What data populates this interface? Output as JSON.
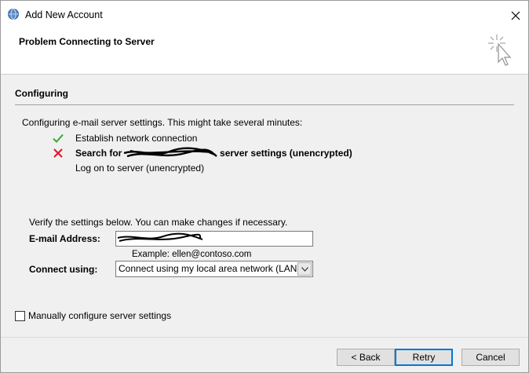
{
  "window": {
    "title": "Add New Account",
    "icon": "outlook-account-icon"
  },
  "header": {
    "title": "Problem Connecting to Server",
    "icon": "wizard-cursor-icon"
  },
  "section": {
    "title": "Configuring"
  },
  "progress": {
    "intro": "Configuring e-mail server settings. This might take several minutes:",
    "steps": [
      {
        "label": "Establish network connection",
        "status": "success",
        "icon": "check-icon"
      },
      {
        "label": "Search for ",
        "label_suffix": " server settings (unencrypted)",
        "status": "failed",
        "icon": "error-x-icon"
      },
      {
        "label": "Log on to server (unencrypted)",
        "status": "pending"
      }
    ]
  },
  "form": {
    "verify_text": "Verify the settings below. You can make changes if necessary.",
    "email_label": "E-mail Address:",
    "email_value": "",
    "email_example": "Example: ellen@contoso.com",
    "connect_label": "Connect using:",
    "connect_value": "Connect using my local area network (LAN)",
    "manual_label": "Manually configure server settings",
    "manual_checked": false
  },
  "buttons": {
    "back": "< Back",
    "retry": "Retry",
    "cancel": "Cancel"
  },
  "colors": {
    "success": "#3aa935",
    "error": "#e81123",
    "accent": "#0078d7"
  }
}
